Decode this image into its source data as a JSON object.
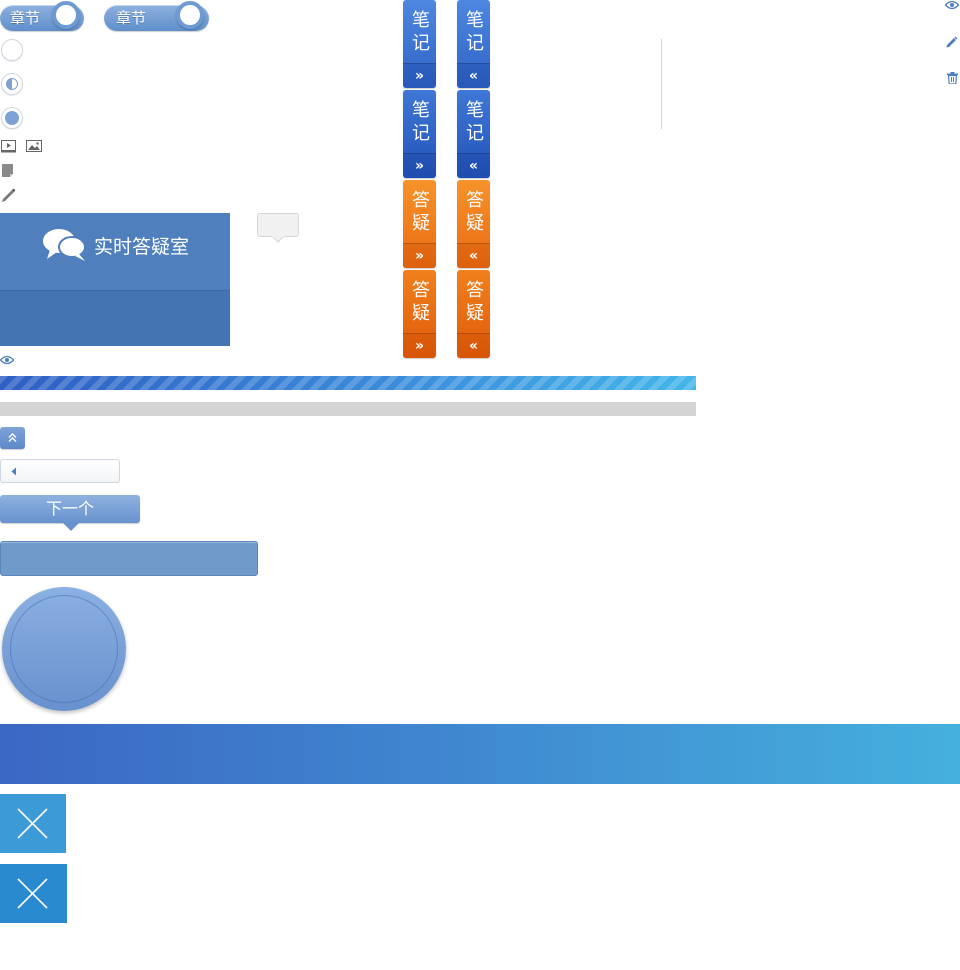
{
  "chapter_toggles": [
    {
      "label": "章节"
    },
    {
      "label": "章节"
    }
  ],
  "status_circles": [
    "empty",
    "half",
    "full"
  ],
  "media_icons": [
    "video-icon",
    "image-icon",
    "document-icon",
    "pencil-icon"
  ],
  "qa_card": {
    "title": "实时答疑室",
    "icon": "chat-bubbles-icon"
  },
  "side_tabs": {
    "notes_label": "笔记",
    "qa_label": "答疑",
    "expand_arrow": "»",
    "collapse_arrow": "«"
  },
  "right_actions": [
    "eye-icon",
    "edit-icon",
    "trash-icon"
  ],
  "next_button": {
    "label": "下一个"
  },
  "colors": {
    "accent_blue": "#4f7fbd",
    "tab_blue": "#3a73d4",
    "tab_orange": "#f0801d",
    "close_tile_light": "#3c9ad6",
    "close_tile_dark": "#2a8ad0"
  },
  "progress_bar": {
    "fill": 1.0
  }
}
